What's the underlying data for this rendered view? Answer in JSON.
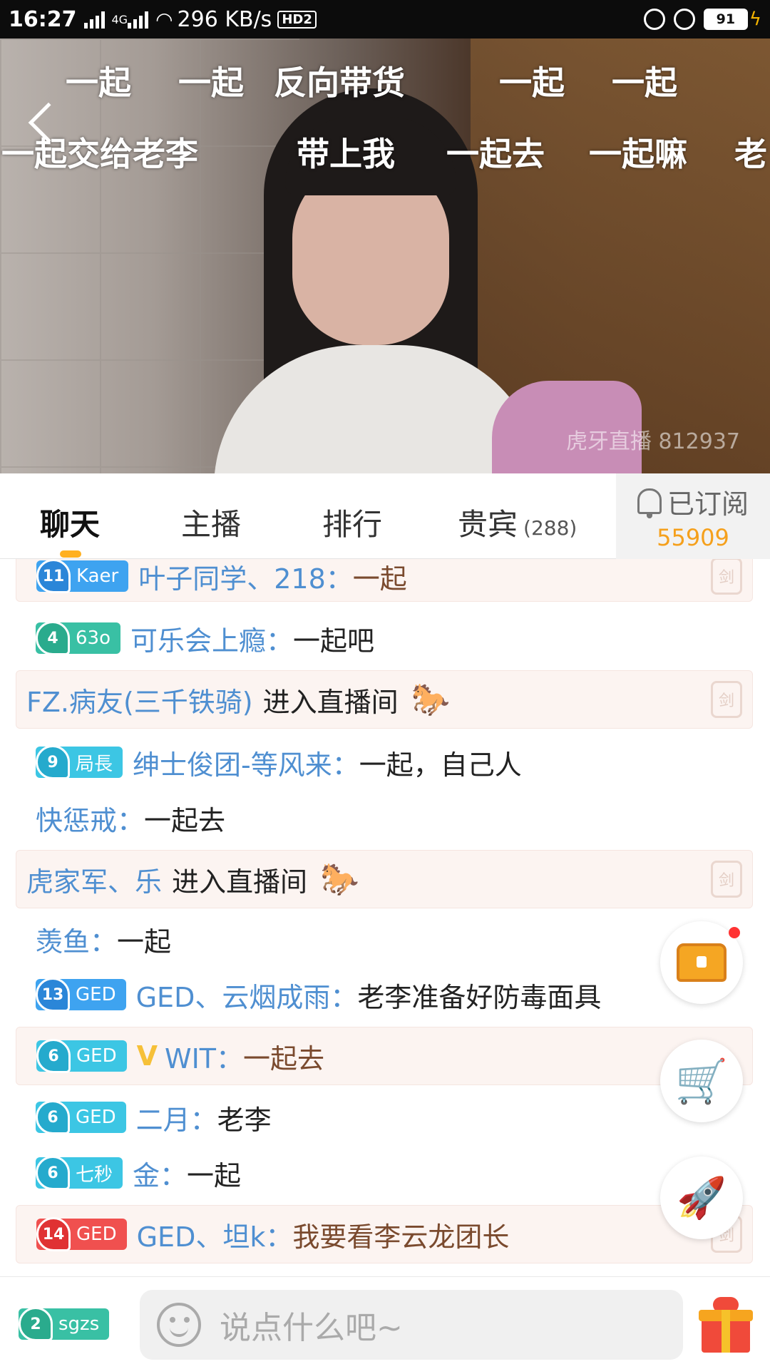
{
  "status_bar": {
    "time": "16:27",
    "network_type": "4G",
    "speed": "296 KB/s",
    "hd": "HD2",
    "battery": "91"
  },
  "video": {
    "danmaku_row1": [
      "一起",
      "一起",
      "反向带货",
      "一起",
      "一起"
    ],
    "danmaku_row2": [
      "一起交给老李",
      "带上我",
      "一起去",
      "一起嘛",
      "老"
    ],
    "watermark": "虎牙直播 812937"
  },
  "tabs": {
    "chat": "聊天",
    "host": "主播",
    "rank": "排行",
    "vip": "贵宾",
    "vip_count": "(288)",
    "subscribe_label": "已订阅",
    "subscribe_count": "55909"
  },
  "chat_messages": [
    {
      "badge_level": "11",
      "badge_name": "Kaer",
      "nick": "叶子同学、218：",
      "text": "一起"
    },
    {
      "badge_level": "4",
      "badge_name": "63o",
      "nick": "可乐会上瘾：",
      "text": "一起吧"
    },
    {
      "nick": "FZ.病友(三千铁骑)",
      "text": "进入直播间"
    },
    {
      "badge_level": "9",
      "badge_name": "局長",
      "nick": "绅士俊团-等风来：",
      "text": "一起，自己人"
    },
    {
      "nick": "快惩戒：",
      "text": "一起去"
    },
    {
      "nick": "虎家军、乐",
      "text": "进入直播间"
    },
    {
      "nick": "羡鱼：",
      "text": "一起"
    },
    {
      "badge_level": "13",
      "badge_name": "GED",
      "nick": "GED、云烟成雨：",
      "text": "老李准备好防毒面具"
    },
    {
      "badge_level": "6",
      "badge_name": "GED",
      "nick": "WIT：",
      "text": "一起去"
    },
    {
      "badge_level": "6",
      "badge_name": "GED",
      "nick": "二月：",
      "text": "老李"
    },
    {
      "badge_level": "6",
      "badge_name": "七秒",
      "nick": "金：",
      "text": "一起"
    },
    {
      "badge_level": "14",
      "badge_name": "GED",
      "nick": "GED、坦k：",
      "text": "我要看李云龙团长"
    }
  ],
  "bottom_bar": {
    "my_badge_level": "2",
    "my_badge_name": "sgzs",
    "input_placeholder": "说点什么吧~"
  },
  "colors": {
    "accent": "#ffb01f",
    "nick": "#4f8fd1",
    "subscribe_count": "#f5a01c"
  }
}
